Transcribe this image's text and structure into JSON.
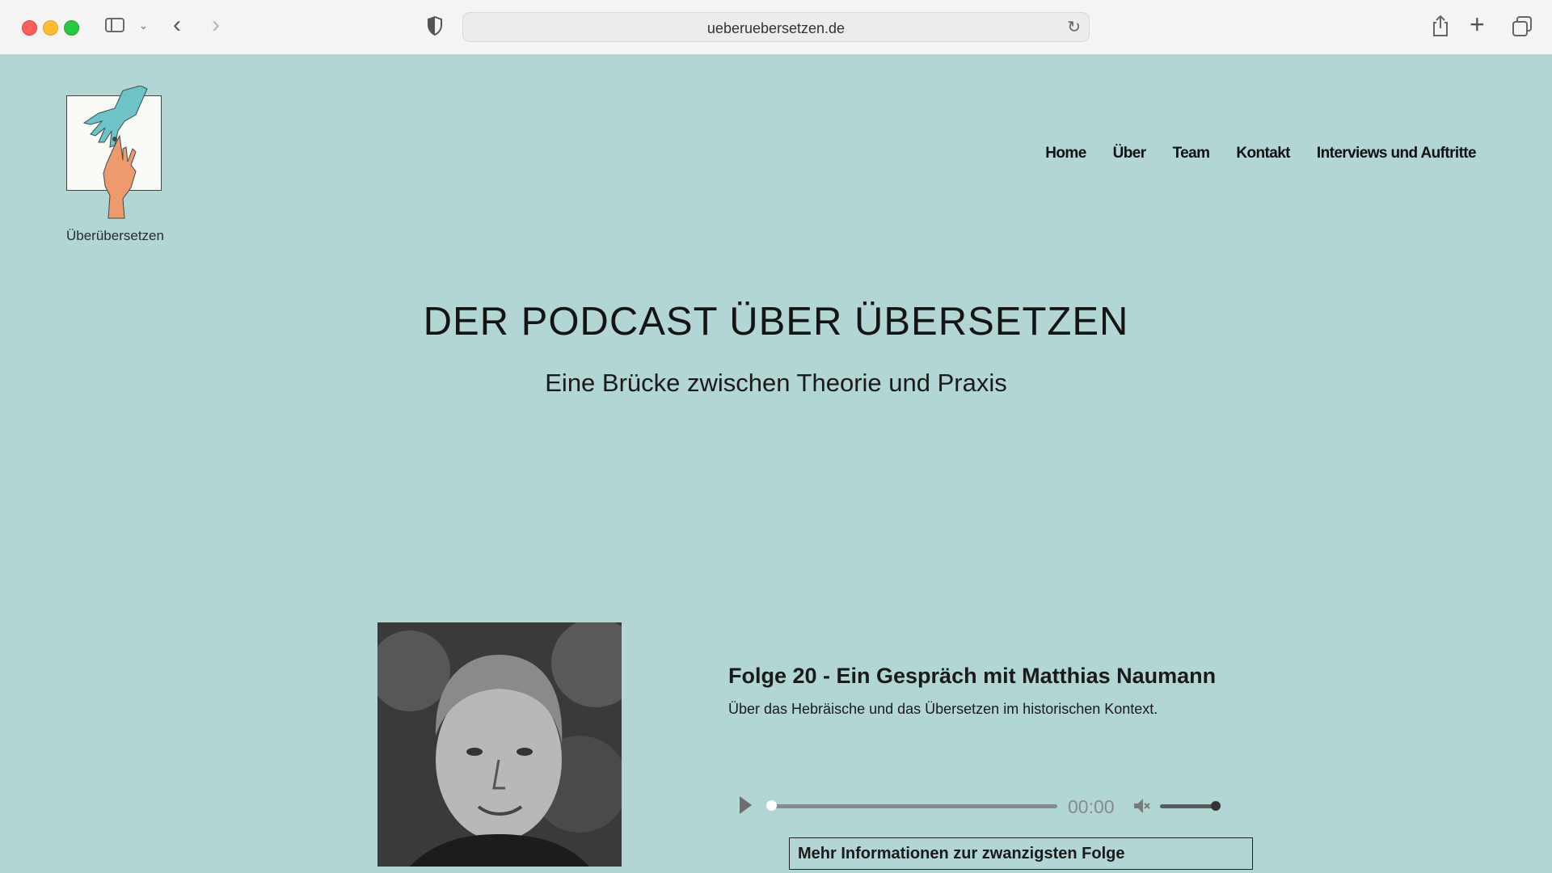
{
  "browser": {
    "url": "ueberuebersetzen.de",
    "icons": [
      "sidebar-icon",
      "chevron-down-icon",
      "back-arrow-icon",
      "forward-arrow-icon",
      "shield-icon",
      "reload-icon",
      "share-icon",
      "plus-icon",
      "tabs-overview-icon"
    ]
  },
  "site": {
    "logo_text": "Überübersetzen",
    "nav": [
      "Home",
      "Über",
      "Team",
      "Kontakt",
      "Interviews und Auftritte"
    ]
  },
  "hero": {
    "title": "DER PODCAST ÜBER ÜBERSETZEN",
    "subtitle": "Eine Brücke zwischen Theorie und Praxis"
  },
  "episode": {
    "title": "Folge 20 - Ein Gespräch mit Matthias Naumann",
    "description": "Über das Hebräische und das Übersetzen im historischen Kontext.",
    "time": "00:00",
    "progress": 0,
    "volume": 1,
    "more_link": "Mehr Informationen zur zwanzigsten Folge"
  },
  "colors": {
    "page_bg": "#b2d6d3",
    "chrome_bg": "#f5f4f4",
    "logo_hand_top": "#6cc4c9",
    "logo_hand_bottom": "#ef9a6c"
  }
}
